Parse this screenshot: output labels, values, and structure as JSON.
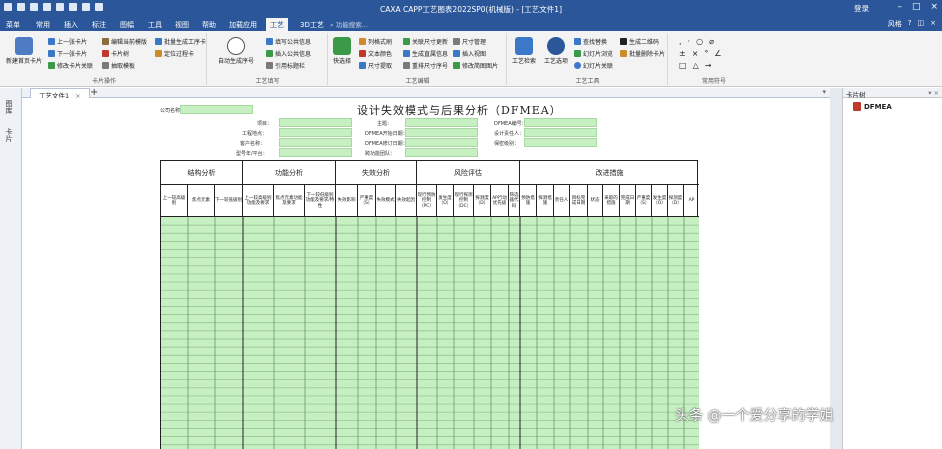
{
  "app": {
    "window_title": "CAXA CAPP工艺图表2022SP0(机械版) - [工艺文件1]",
    "login": "登录"
  },
  "menu": {
    "items": [
      "菜单",
      "常用",
      "插入",
      "标注",
      "图幅",
      "工具",
      "视图",
      "帮助",
      "加载应用",
      "工艺",
      "3D工艺"
    ],
    "active": "工艺",
    "search_placeholder": "功能搜索...",
    "style": "风格",
    "help_icon": "?"
  },
  "ribbon": {
    "groups": [
      {
        "label": "卡片操作"
      },
      {
        "label": "工艺填写"
      },
      {
        "label": "工艺编辑"
      },
      {
        "label": "工艺工具"
      },
      {
        "label": "常用符号"
      }
    ],
    "card_ops": {
      "new_first_card": "新建首页卡片",
      "prev_card": "上一张卡片",
      "next_card": "下一张卡片",
      "modify_card_relation": "修改卡片关联",
      "edit_current_template": "编辑当前模版",
      "card_tree": "卡片树",
      "extract_template": "抽取模板",
      "batch_generate": "批量生成工序卡",
      "locate_process": "定位过程卡"
    },
    "fill": {
      "auto_seq": "自动生成序号",
      "fill_public": "填写公共信息",
      "insert_public": "插入公共信息",
      "cite_title_bar": "引用标题栏"
    },
    "edit": {
      "fast_select": "快选择",
      "row_format": "列格式刷",
      "text_color": "文本颜色",
      "size_extract": "尺寸提取",
      "relate_size_update": "关联尺寸更新",
      "generate_detail": "生成直属信息",
      "rearrange_seq": "重排尺寸序号",
      "size_mgmt": "尺寸管理",
      "insert_view": "插入视图",
      "modify_sketch": "修改简图图片"
    },
    "tools": {
      "process_search": "工艺检索",
      "process_options": "工艺选项",
      "find_replace": "查找替换",
      "card_browse": "幻灯片浏览",
      "card_relation": "幻灯片关联",
      "gen_qr": "生成二维码",
      "batch_delete": "批量删除卡片"
    }
  },
  "tabs": {
    "doc_tab": "工艺文件1",
    "close": "×",
    "add": "+"
  },
  "left_sidebar": [
    "图库",
    "卡片"
  ],
  "right_panel": {
    "title": "卡片树",
    "item": "DFMEA"
  },
  "document": {
    "title": "设计失效模式与后果分析（DFMEA）",
    "header_fields": {
      "company_label": "公司名称",
      "project_label": "项目：",
      "engineer_label": "工程地点：",
      "customer_label": "客户名称：",
      "model_label": "型号年/平台：",
      "subject_label": "主题：",
      "start_date_label": "DFMEA开始日期：",
      "revision_date_label": "DFMEA修订日期：",
      "cross_team_label": "跨功能团队：",
      "dfmea_no_label": "DFMEA编号：",
      "owner_label": "设计责任人：",
      "confidentiality_label": "保密级别："
    },
    "sections": [
      {
        "label": "结构分析"
      },
      {
        "label": "功能分析"
      },
      {
        "label": "失效分析"
      },
      {
        "label": "风险评估"
      },
      {
        "label": "改进措施"
      }
    ],
    "columns": [
      "上一较高级别",
      "焦点元素",
      "下一较低级别",
      "上一较高级别功能及要求",
      "焦点元素功能及要求",
      "下一较低级别功能及要求/特性",
      "失效影响",
      "严重度（S）",
      "失效模式",
      "失效起因",
      "现行预防控制（PC）",
      "发生度（O）",
      "现行探测控制（DC）",
      "探测度（D）",
      "AP行动优先级",
      "筛选器代码",
      "预防措施",
      "探测措施",
      "责任人",
      "目标完成日期",
      "状态",
      "采取的措施",
      "完成日期",
      "严重度（S）",
      "发生度（O）",
      "探测度（D）",
      "AP"
    ],
    "row_count": 30
  },
  "watermark": "头条 @一个爱分享的学姐"
}
